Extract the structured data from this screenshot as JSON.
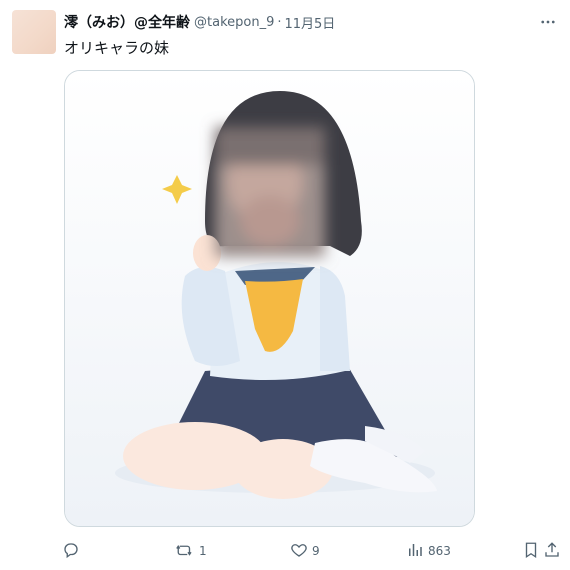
{
  "post": {
    "display_name": "澪（みお）@全年齢",
    "handle": "@takepon_9",
    "separator": "·",
    "date": "11月5日",
    "text": "オリキャラの妹"
  },
  "actions": {
    "reply_count": "",
    "retweet_count": "1",
    "like_count": "9",
    "view_count": "863"
  },
  "colors": {
    "text": "#0f1419",
    "muted": "#536471",
    "border": "#cfd9de"
  },
  "icons": [
    "more-icon",
    "reply-icon",
    "retweet-icon",
    "like-icon",
    "views-icon",
    "bookmark-icon",
    "share-icon"
  ]
}
